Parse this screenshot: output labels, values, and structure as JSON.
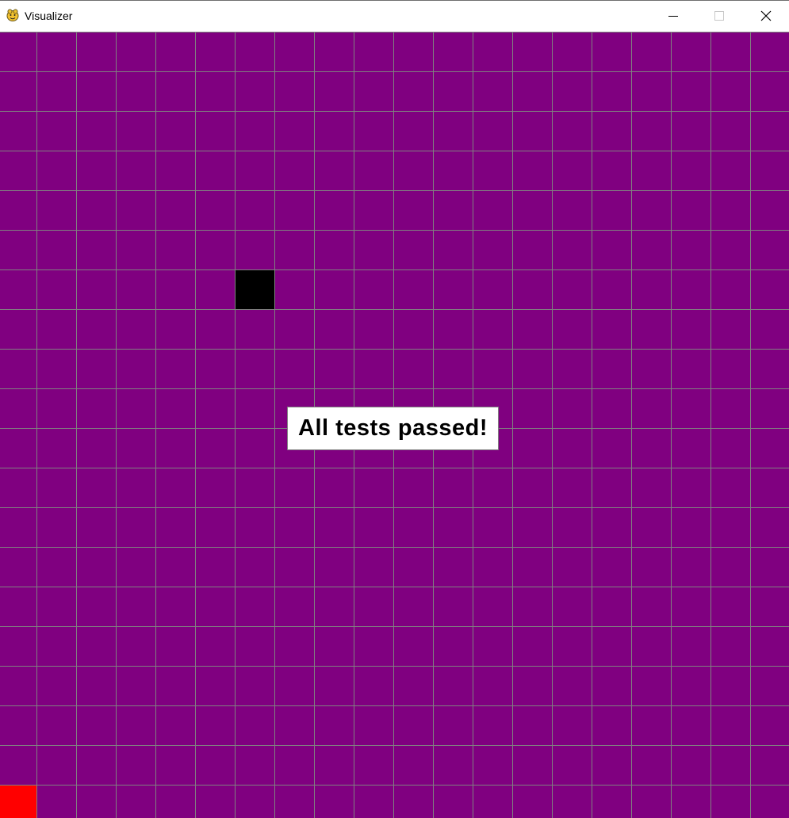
{
  "window": {
    "title": "Visualizer",
    "icon": "pygame-snake-icon"
  },
  "controls": {
    "minimize_icon": "minimize-icon",
    "maximize_icon": "maximize-icon",
    "close_icon": "close-icon"
  },
  "board": {
    "columns": 20,
    "rows": 20,
    "cell_color": "#800080",
    "grid_line_color": "#808080",
    "special_cells": [
      {
        "col": 6,
        "row": 6,
        "color": "#000000",
        "name": "obstacle-cell"
      },
      {
        "col": 0,
        "row": 19,
        "color": "#ff0000",
        "name": "start-cell"
      }
    ]
  },
  "status": {
    "message": "All tests passed!"
  }
}
